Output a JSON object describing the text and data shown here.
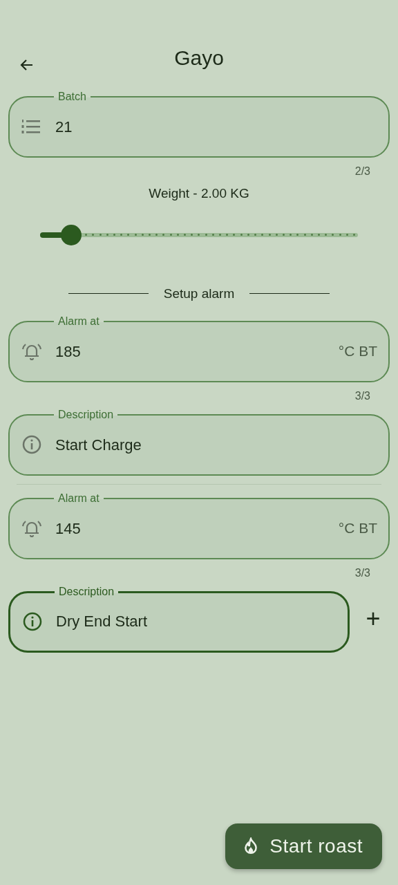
{
  "app_bar": {
    "title": "Gayo"
  },
  "batch": {
    "label": "Batch",
    "value": "21",
    "counter": "2/3",
    "focused": false
  },
  "weight": {
    "label": "Weight - 2.00 KG",
    "level": 0.097
  },
  "alarm_section": {
    "title": "Setup alarm"
  },
  "alarms": [
    {
      "alarm_at": {
        "label": "Alarm at",
        "value": "185",
        "suffix": "°C BT",
        "counter": "3/3",
        "focused": false
      },
      "description": {
        "label": "Description",
        "value": "Start Charge",
        "focused": false
      }
    },
    {
      "alarm_at": {
        "label": "Alarm at",
        "value": "145",
        "suffix": "°C BT",
        "counter": "3/3",
        "focused": false
      },
      "description": {
        "label": "Description",
        "value": "Dry End Start",
        "focused": true
      }
    }
  ],
  "add_button": {
    "label": "+"
  },
  "start_button": {
    "label": "Start roast"
  }
}
